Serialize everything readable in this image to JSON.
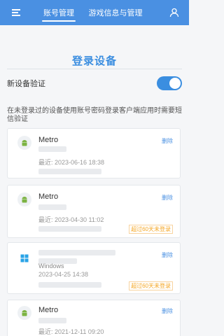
{
  "header": {
    "tab_account": "账号管理",
    "tab_game": "游戏信息与管理"
  },
  "page": {
    "title": "登录设备",
    "toggle_label": "新设备验证",
    "toggle_on": true,
    "description": "在未登录过的设备使用账号密码登录客户端应用时需要短信验证"
  },
  "devices": [
    {
      "name": "Metro",
      "os": "android-icon",
      "recent": "最近: 2023-06-16 18:38",
      "delete": "删除",
      "badge": ""
    },
    {
      "name": "Metro",
      "os": "android-icon",
      "recent": "最近: 2023-04-30 11:02",
      "delete": "删除",
      "badge": "超过60天未登录"
    },
    {
      "name": "Windows",
      "os": "windows-icon",
      "recent": "2023-04-25 14:38",
      "delete": "删除",
      "badge": "超过60天未登录"
    },
    {
      "name": "Metro",
      "os": "android-icon",
      "recent": "最近: 2021-12-11 09:20",
      "delete": "删除",
      "badge": ""
    }
  ],
  "colors": {
    "header_bg": "#4a90e2",
    "accent": "#3b8ee0",
    "warning": "#f5a623"
  }
}
